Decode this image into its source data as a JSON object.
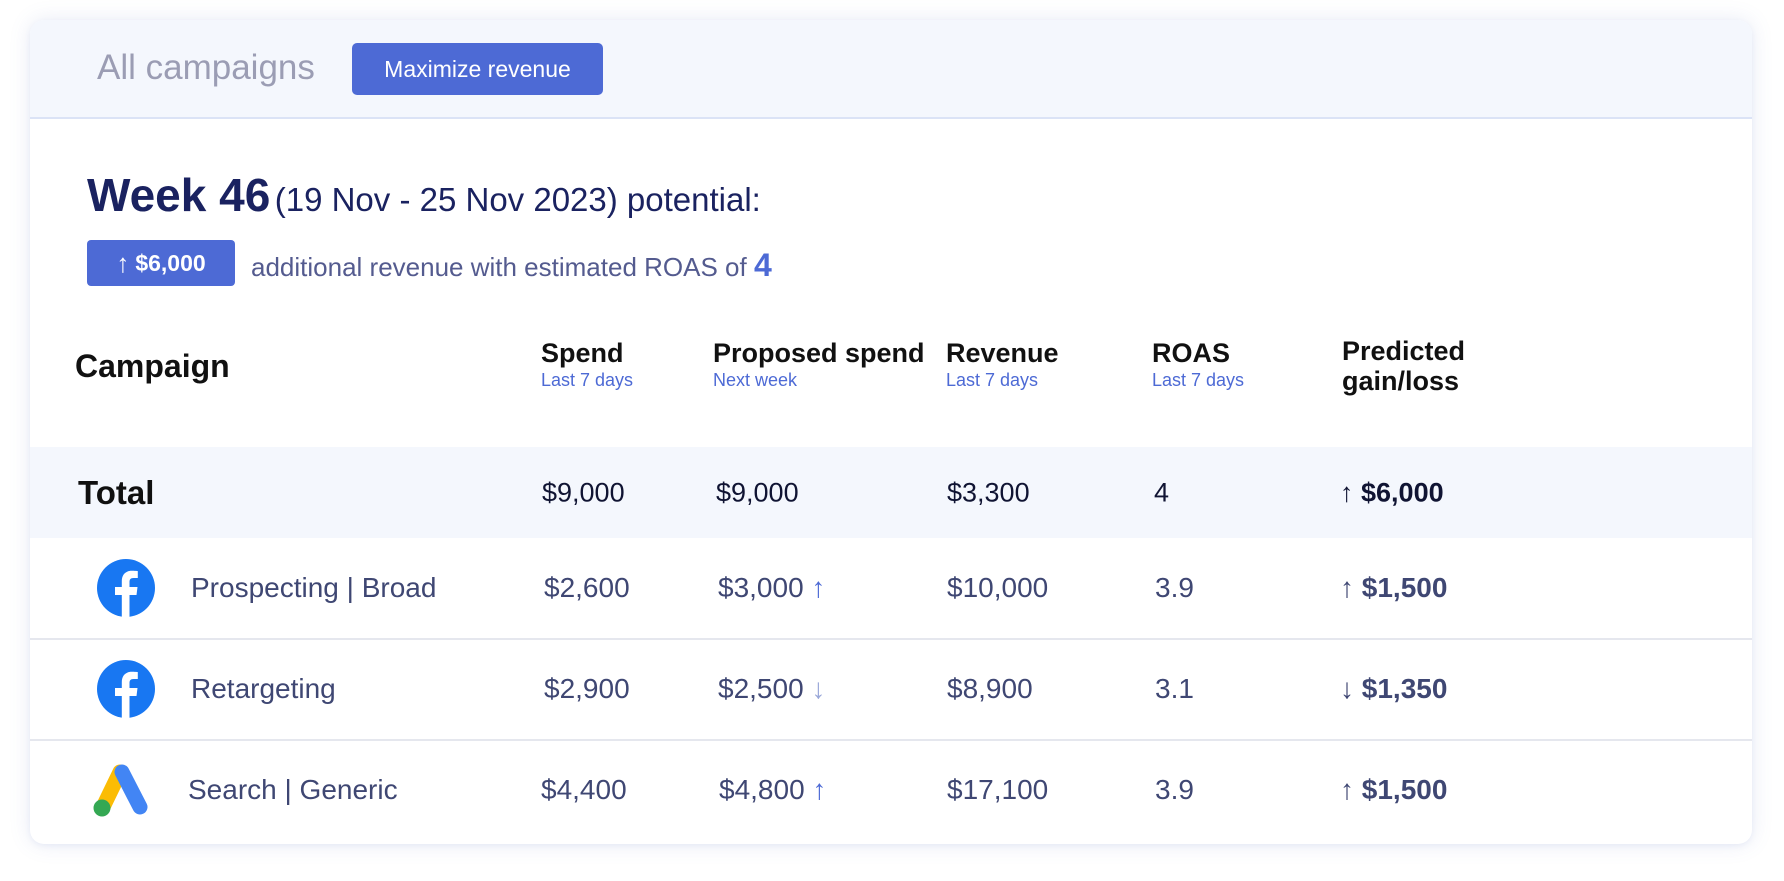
{
  "header": {
    "title": "All campaigns",
    "button_label": "Maximize revenue"
  },
  "summary": {
    "week_label": "Week 46",
    "week_range": "(19 Nov - 25 Nov 2023) potential:",
    "badge_arrow": "↑",
    "badge_value": "$6,000",
    "additional_text": "additional revenue with estimated ROAS of",
    "estimated_roas": "4"
  },
  "columns": {
    "campaign": "Campaign",
    "spend": {
      "label": "Spend",
      "sub": "Last 7 days"
    },
    "proposed": {
      "label": "Proposed spend",
      "sub": "Next week"
    },
    "revenue": {
      "label": "Revenue",
      "sub": "Last 7 days"
    },
    "roas": {
      "label": "ROAS",
      "sub": "Last 7 days"
    },
    "gain": {
      "line1": "Predicted",
      "line2": "gain/loss"
    }
  },
  "total": {
    "label": "Total",
    "spend": "$9,000",
    "proposed": "$9,000",
    "revenue": "$3,300",
    "roas": "4",
    "gain_arrow": "↑",
    "gain": "$6,000"
  },
  "rows": [
    {
      "icon": "facebook-icon",
      "name": "Prospecting | Broad",
      "spend": "$2,600",
      "proposed": "$3,000",
      "proposed_arrow": "↑",
      "revenue": "$10,000",
      "roas": "3.9",
      "gain_arrow": "↑",
      "gain": "$1,500",
      "direction": "up"
    },
    {
      "icon": "facebook-icon",
      "name": "Retargeting",
      "spend": "$2,900",
      "proposed": "$2,500",
      "proposed_arrow": "↓",
      "revenue": "$8,900",
      "roas": "3.1",
      "gain_arrow": "↓",
      "gain": "$1,350",
      "direction": "down"
    },
    {
      "icon": "google-ads-icon",
      "name": "Search | Generic",
      "spend": "$4,400",
      "proposed": "$4,800",
      "proposed_arrow": "↑",
      "revenue": "$17,100",
      "roas": "3.9",
      "gain_arrow": "↑",
      "gain": "$1,500",
      "direction": "up"
    }
  ],
  "colors": {
    "accent": "#4d6ad5",
    "header_bg": "#f4f7fd",
    "loss": "#a2aedb",
    "facebook": "#1877f2",
    "google_yellow": "#fbbc04",
    "google_blue": "#4285f4",
    "google_green": "#34a853"
  }
}
